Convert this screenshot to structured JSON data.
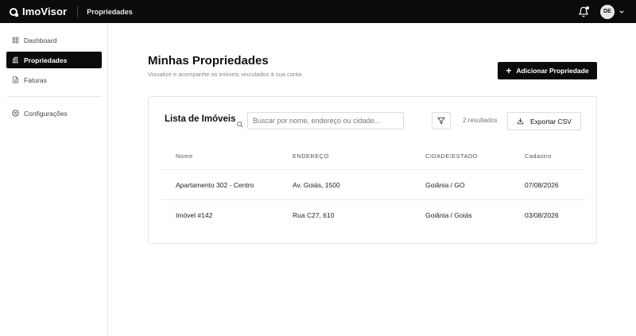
{
  "topbar": {
    "brand": "ImoVisor",
    "page": "Propriedades",
    "avatar_initials": "DE"
  },
  "sidebar": {
    "items": [
      {
        "label": "Dashboard",
        "icon": "grid-icon",
        "active": false
      },
      {
        "label": "Propriedades",
        "icon": "building-icon",
        "active": true
      },
      {
        "label": "Faturas",
        "icon": "document-icon",
        "active": false
      }
    ],
    "settings": {
      "label": "Configurações",
      "icon": "gear-icon"
    }
  },
  "main": {
    "title": "Minhas Propriedades",
    "subtitle": "Visualize e acompanhe os imóveis vinculados à sua conta",
    "add_button": "Adicionar Propriedade"
  },
  "card": {
    "title": "Lista de Imóveis",
    "search_placeholder": "Buscar por nome, endereço ou cidade...",
    "results": "2 resultados",
    "export_button": "Exportar CSV"
  },
  "table": {
    "columns": [
      "Nome",
      "ENDEREÇO",
      "CIDADE/ESTADO",
      "Cadastro"
    ],
    "rows": [
      [
        "Apartamento 302 - Centro",
        "Av. Goiás, 1500",
        "Goiânia / GO",
        "07/08/2026"
      ],
      [
        "Imóvel #142",
        "Rua C27, 610",
        "Goiânia / Goiás",
        "03/08/2026"
      ]
    ]
  },
  "colors": {
    "dark": "#0b0b0b",
    "border": "#e6e6e6",
    "muted": "#888888"
  }
}
